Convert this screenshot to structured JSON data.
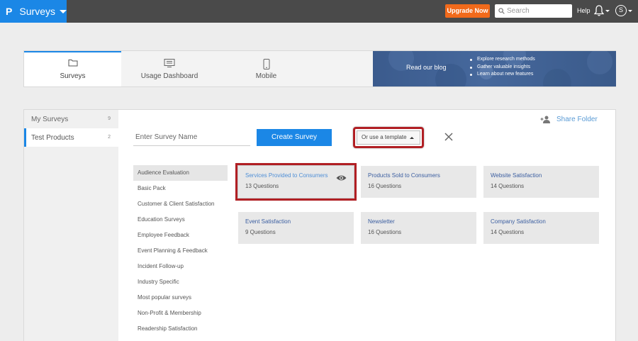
{
  "topbar": {
    "logo": "P",
    "app_title": "Surveys",
    "upgrade_label": "Upgrade Now",
    "search_placeholder": "Search",
    "help_label": "Help",
    "avatar_initial": "S"
  },
  "tabs": [
    {
      "label": "Surveys",
      "icon": "folder-icon",
      "active": true
    },
    {
      "label": "Usage Dashboard",
      "icon": "dashboard-icon",
      "active": false
    },
    {
      "label": "Mobile",
      "icon": "mobile-icon",
      "active": false
    }
  ],
  "blog": {
    "read_label": "Read our blog",
    "bullets": [
      "Explore research methods",
      "Gather valuable insights",
      "Learn about new features"
    ]
  },
  "sidebar": {
    "items": [
      {
        "name": "My Surveys",
        "count": "9"
      },
      {
        "name": "Test Products",
        "count": "2"
      }
    ]
  },
  "toolbar": {
    "share_label": "Share Folder",
    "survey_name_placeholder": "Enter Survey Name",
    "create_label": "Create Survey",
    "template_label": "Or use a template"
  },
  "categories": [
    "Audience Evaluation",
    "Basic Pack",
    "Customer & Client Satisfaction",
    "Education Surveys",
    "Employee Feedback",
    "Event Planning & Feedback",
    "Incident Follow-up",
    "Industry Specific",
    "Most popular surveys",
    "Non-Profit & Membership",
    "Readership Satisfaction"
  ],
  "templates": [
    {
      "title": "Services Provided to Consumers",
      "questions": "13 Questions"
    },
    {
      "title": "Products Sold to Consumers",
      "questions": "16 Questions"
    },
    {
      "title": "Website Satisfaction",
      "questions": "14 Questions"
    },
    {
      "title": "Event Satisfaction",
      "questions": "9 Questions"
    },
    {
      "title": "Newsletter",
      "questions": "16 Questions"
    },
    {
      "title": "Company Satisfaction",
      "questions": "14 Questions"
    }
  ],
  "colors": {
    "brand_blue": "#1b87e6",
    "topbar": "#4a4a4a",
    "upgrade_orange": "#f26a1b",
    "highlight_red": "#b11f24"
  }
}
